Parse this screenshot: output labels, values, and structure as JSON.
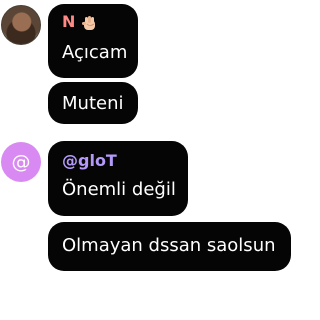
{
  "messages": [
    {
      "sender": "N",
      "sender_color": "#ff8a85",
      "sender_emoji": "hand-emoji-icon",
      "avatar": "profile-photo",
      "text": "Açıcam"
    },
    {
      "text": "Muteni"
    },
    {
      "sender": "@gloT",
      "sender_color": "#b39af9",
      "avatar": "at-sign-avatar",
      "avatar_symbol": "@",
      "avatar_color": "#d98af2",
      "text": "Önemli değil"
    },
    {
      "text": "Olmayan dssan saolsun"
    }
  ],
  "colors": {
    "bubble": "#050505",
    "background": "#ffffff",
    "text": "#ffffff"
  }
}
